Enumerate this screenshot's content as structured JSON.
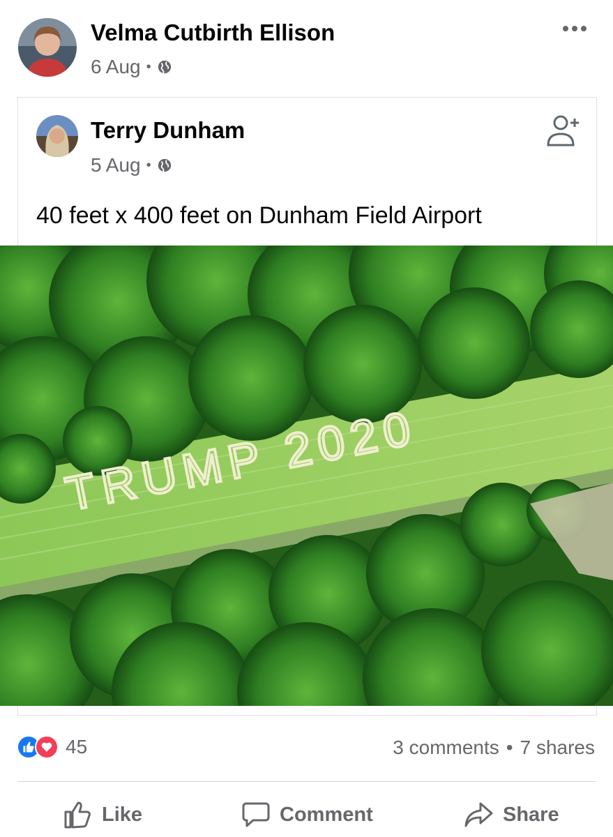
{
  "post": {
    "author": "Velma Cutbirth Ellison",
    "date": "6 Aug",
    "privacy_icon": "globe-icon",
    "more_icon": "more-options-icon"
  },
  "shared_post": {
    "author": "Terry Dunham",
    "date": "5 Aug",
    "privacy_icon": "globe-icon",
    "text": "40 feet x 400 feet on Dunham Field Airport",
    "photo_text": "TRUMP 2020",
    "add_friend_icon": "add-friend-icon"
  },
  "stats": {
    "reaction_count": "45",
    "comments": "3 comments",
    "shares": "7 shares",
    "separator": "•"
  },
  "actions": {
    "like": "Like",
    "comment": "Comment",
    "share": "Share"
  },
  "colors": {
    "like_blue": "#1877f2",
    "love_red": "#f33e58",
    "muted_text": "#65676b",
    "grass": "#7ec04a",
    "trees": "#2e7d1e"
  }
}
